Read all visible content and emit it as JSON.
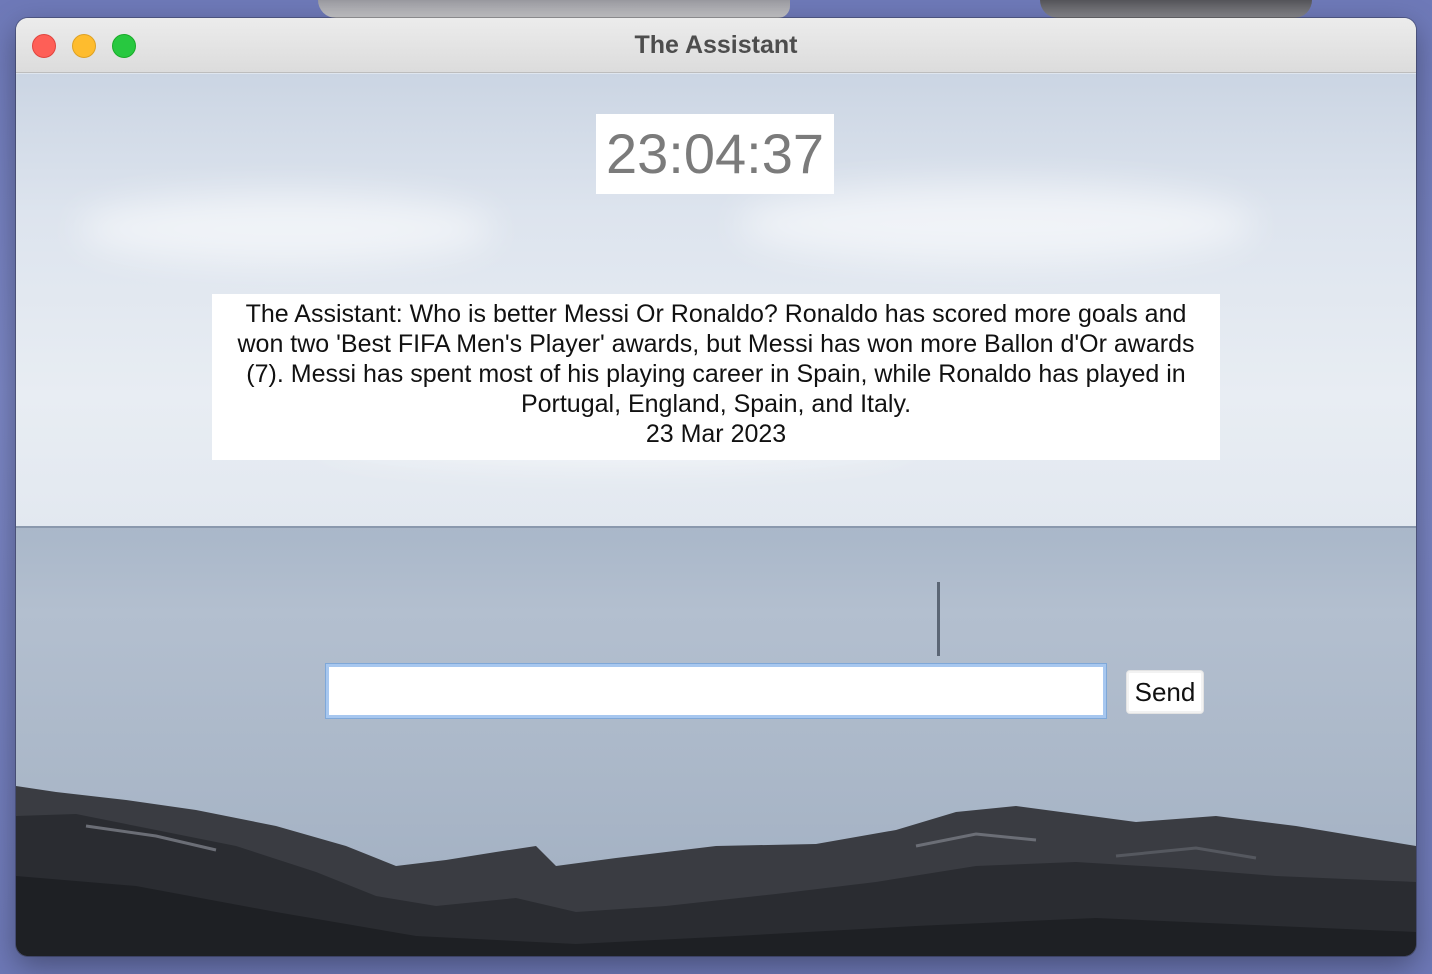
{
  "window": {
    "title": "The Assistant"
  },
  "clock": {
    "time": "23:04:37"
  },
  "message": {
    "text": "The Assistant: Who is better Messi Or Ronaldo? Ronaldo has scored more goals and won two 'Best FIFA Men's Player' awards, but Messi has won more Ballon d'Or awards (7). Messi has spent most of his playing career in Spain, while Ronaldo has played in Portugal, England, Spain, and Italy.",
    "date": "23 Mar 2023"
  },
  "input": {
    "value": "",
    "send_label": "Send"
  },
  "colors": {
    "close": "#fe5f57",
    "minimize": "#febc2e",
    "zoom": "#28c840",
    "input_focus": "#a7c7ef"
  },
  "icons": [
    "close-icon",
    "minimize-icon",
    "zoom-icon"
  ]
}
